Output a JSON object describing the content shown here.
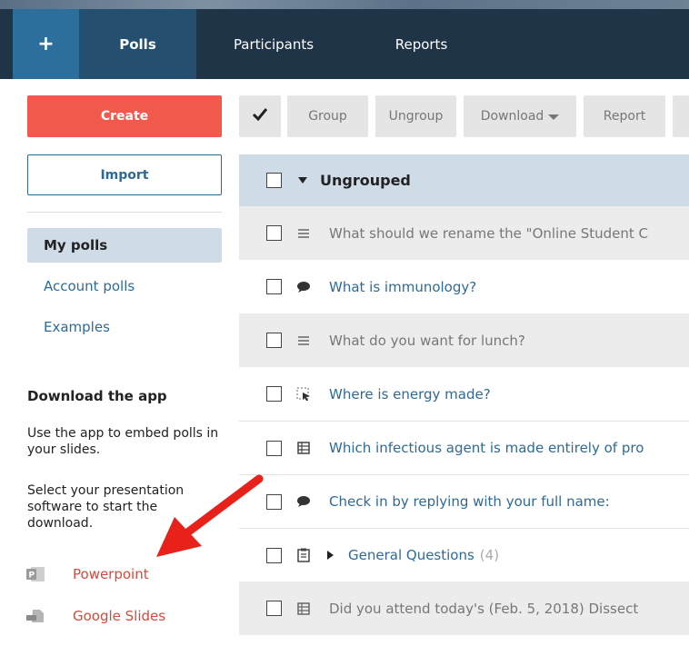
{
  "nav": {
    "plus_label": "+",
    "tabs": [
      {
        "label": "Polls",
        "active": true
      },
      {
        "label": "Participants",
        "active": false
      },
      {
        "label": "Reports",
        "active": false
      }
    ]
  },
  "sidebar": {
    "create_label": "Create",
    "import_label": "Import",
    "items": [
      {
        "label": "My polls",
        "active": true
      },
      {
        "label": "Account polls",
        "active": false
      },
      {
        "label": "Examples",
        "active": false
      }
    ],
    "download": {
      "heading": "Download the app",
      "text1": "Use the app to embed polls in your slides.",
      "text2": "Select your presentation software to start the download.",
      "apps": [
        {
          "label": "Powerpoint",
          "icon": "powerpoint-icon"
        },
        {
          "label": "Google Slides",
          "icon": "google-slides-icon"
        }
      ]
    }
  },
  "toolbar": {
    "check_icon": "checkmark-icon",
    "buttons": [
      "Group",
      "Ungroup",
      "Download",
      "Report"
    ]
  },
  "list": {
    "group_header": "Ungrouped",
    "rows": [
      {
        "icon": "open-ended-icon",
        "text": "What should we rename the \"Online Student C",
        "color": "grey"
      },
      {
        "icon": "speech-bubble-icon",
        "text": "What is immunology?",
        "color": "blue"
      },
      {
        "icon": "open-ended-icon",
        "text": "What do you want for lunch?",
        "color": "grey"
      },
      {
        "icon": "clickable-image-icon",
        "text": "Where is energy made?",
        "color": "blue"
      },
      {
        "icon": "multiple-choice-icon",
        "text": "Which infectious agent is made entirely of pro",
        "color": "blue"
      },
      {
        "icon": "speech-bubble-icon",
        "text": "Check in by replying with your full name:",
        "color": "blue"
      },
      {
        "icon": "clipboard-icon",
        "text": "General Questions",
        "count": "(4)",
        "color": "blue",
        "group": true
      },
      {
        "icon": "multiple-choice-icon",
        "text": "Did you attend today's (Feb. 5, 2018) Dissect",
        "color": "grey"
      }
    ]
  },
  "colors": {
    "nav_bg": "#1f3447",
    "nav_active": "#254f6f",
    "accent_blue": "#2f6a96",
    "create_red": "#f2594d",
    "header_row": "#cfdce8",
    "arrow_red": "#e8221a"
  }
}
